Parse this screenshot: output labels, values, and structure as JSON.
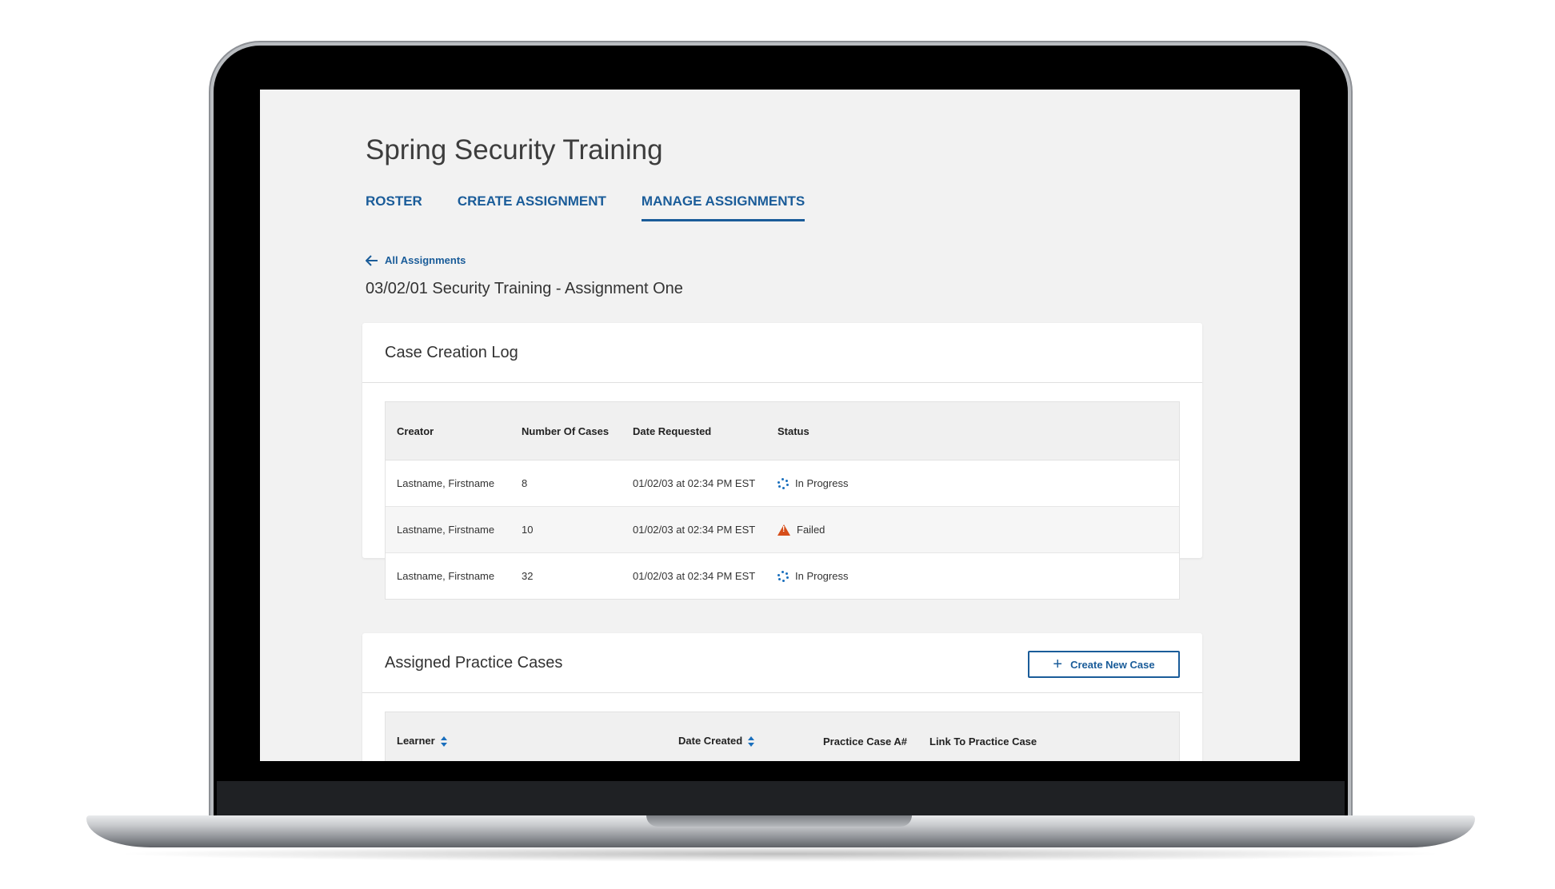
{
  "page": {
    "title": "Spring Security Training",
    "tabs": [
      {
        "label": "ROSTER"
      },
      {
        "label": "CREATE ASSIGNMENT"
      },
      {
        "label": "MANAGE ASSIGNMENTS",
        "active": true
      }
    ],
    "back_link": "All Assignments",
    "subtitle": "03/02/01 Security Training - Assignment One"
  },
  "case_log": {
    "title": "Case Creation Log",
    "columns": [
      "Creator",
      "Number Of Cases",
      "Date Requested",
      "Status"
    ],
    "rows": [
      {
        "creator": "Lastname, Firstname",
        "cases": "8",
        "date": "01/02/03 at 02:34 PM EST",
        "status": "In Progress",
        "status_icon": "spinner-icon"
      },
      {
        "creator": "Lastname, Firstname",
        "cases": "10",
        "date": "01/02/03 at 02:34 PM EST",
        "status": "Failed",
        "status_icon": "warning-icon"
      },
      {
        "creator": "Lastname, Firstname",
        "cases": "32",
        "date": "01/02/03 at 02:34 PM EST",
        "status": "In Progress",
        "status_icon": "spinner-icon"
      }
    ]
  },
  "practice_cases": {
    "title": "Assigned Practice Cases",
    "create_button": "Create New Case",
    "columns": [
      "Learner",
      "Date Created",
      "Practice Case A#",
      "Link To Practice Case"
    ]
  },
  "colors": {
    "accent": "#1a5c99",
    "failed": "#d64e1a",
    "screen_bg": "#f2f2f2"
  }
}
